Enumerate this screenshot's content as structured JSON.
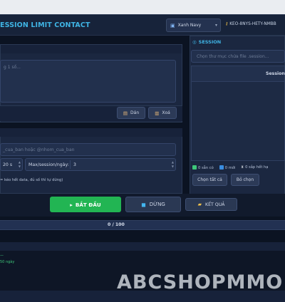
{
  "header": {
    "app_title": "ESSION LIMIT CONTACT",
    "theme_select": {
      "value": "Xanh Navy"
    },
    "license_key": "KEO-8NYS-HETY-NMBB"
  },
  "list_panel": {
    "textarea_placeholder": "g 1 số...",
    "paste_button": "Dán",
    "delete_button": "Xoá"
  },
  "target_panel": {
    "target_placeholder": "_cua_ban  hoặc  @nhom_cua_ban",
    "delay_value": "20 s",
    "max_session_label": "Max/session/ngày:",
    "max_session_value": "3",
    "hint": "= kéo hết data, đủ số thì tự dừng)"
  },
  "session_panel": {
    "title": "SESSION",
    "folder_placeholder": "Chọn thư mục chứa file .session...",
    "table_header": "Session",
    "stats": {
      "ready": "0 sẵn có",
      "new": "0 mới",
      "expiring": "0 sắp hết hạ"
    },
    "select_all_button": "Chọn tất cả",
    "deselect_button": "Bỏ chọn"
  },
  "actions": {
    "start_button": "BẮT ĐẦU",
    "stop_button": "DỪNG",
    "result_button": "KẾT QUẢ"
  },
  "progress": {
    "text": "0 / 100",
    "fraction": 0
  },
  "log": {
    "line1": "—",
    "line2": "50  ngày"
  },
  "watermark": "ABCSHOPMMO",
  "colors": {
    "accent": "#3fb4e4",
    "start": "#22b553",
    "background": "#0b1322",
    "panel": "#1b2740"
  }
}
